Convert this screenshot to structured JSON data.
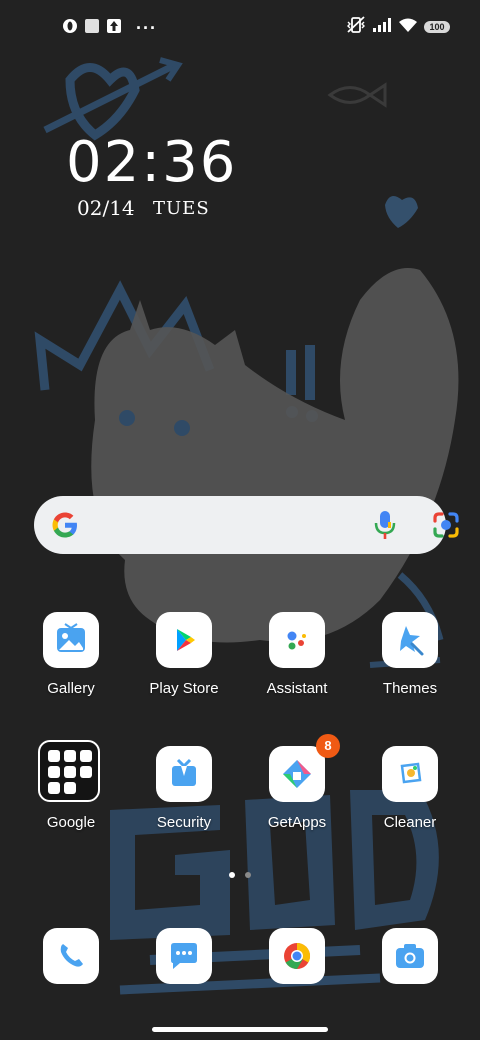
{
  "status_bar": {
    "left_icons": [
      "opera-icon",
      "square-notification-icon",
      "upload-icon"
    ],
    "more": "···",
    "right_icons": [
      "vibrate-off-icon",
      "signal-icon",
      "wifi-icon",
      "battery-icon"
    ],
    "battery": "100"
  },
  "clock": {
    "time": "02:36",
    "date": "02/14",
    "day": "TUES"
  },
  "search": {
    "logo": "google-g-icon",
    "mic": "mic-icon",
    "lens": "lens-camera-icon"
  },
  "apps_row1": [
    {
      "label": "Gallery",
      "icon": "gallery-icon"
    },
    {
      "label": "Play Store",
      "icon": "play-store-icon"
    },
    {
      "label": "Assistant",
      "icon": "assistant-icon"
    },
    {
      "label": "Themes",
      "icon": "themes-icon"
    }
  ],
  "apps_row2": [
    {
      "label": "Google",
      "icon": "folder-icon"
    },
    {
      "label": "Security",
      "icon": "security-icon"
    },
    {
      "label": "GetApps",
      "icon": "getapps-icon",
      "badge": "8"
    },
    {
      "label": "Cleaner",
      "icon": "cleaner-icon"
    }
  ],
  "page_indicator": {
    "pages": 2,
    "current": 1
  },
  "dock": [
    {
      "icon": "phone-icon"
    },
    {
      "icon": "messages-icon"
    },
    {
      "icon": "chrome-icon"
    },
    {
      "icon": "camera-icon"
    }
  ],
  "colors": {
    "accent_blue": "#4aa3f0",
    "badge": "#f05a14",
    "background": "#222222"
  }
}
